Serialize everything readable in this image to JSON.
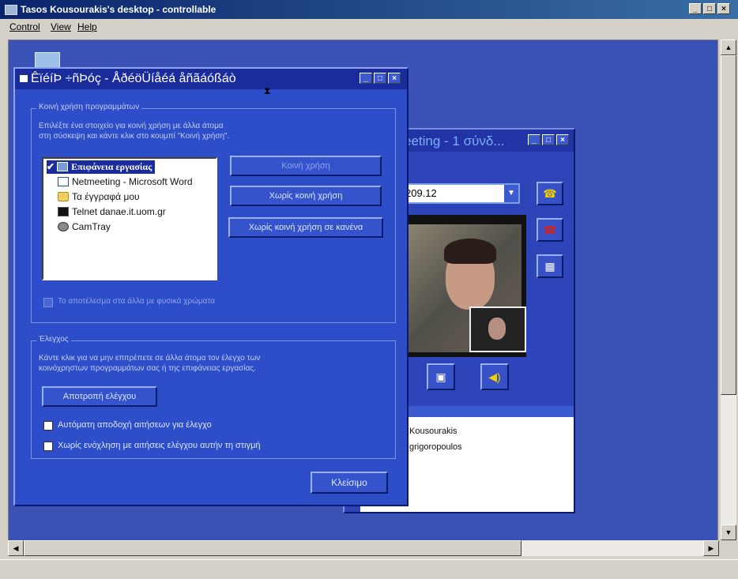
{
  "outer_window": {
    "title": "Tasos Kousourakis's desktop - controllable",
    "buttons": [
      "_",
      "□",
      "×"
    ]
  },
  "menu": [
    "Control",
    "View",
    "Help"
  ],
  "netmeeting": {
    "title": "eeting - 1 σύνδ...",
    "address": "209.12",
    "participants": [
      "Kousourakis",
      "grigoropoulos"
    ]
  },
  "dialog": {
    "title": "ÊïéíÞ ÷ñÞóç - ÅðéöÜíåéá åñãáóßáò",
    "group_sharing": {
      "label": "Κοινή χρήση προγραμμάτων",
      "description_line1": "Επιλέξτε ένα στοιχείο για κοινή χρήση με άλλα άτομα",
      "description_line2": "στη σύσκεψη και κάντε κλικ στο κουμπί \"Κοινή χρήση\"."
    },
    "programs": [
      {
        "label": "Επιφάνεια εργασίας",
        "icon": "desktop-icon",
        "selected": true,
        "checked": "✔"
      },
      {
        "label": "Netmeeting - Microsoft Word",
        "icon": "word-document-icon"
      },
      {
        "label": "Τα έγγραφά μου",
        "icon": "folder-icon"
      },
      {
        "label": "Telnet danae.it.uom.gr",
        "icon": "telnet-icon"
      },
      {
        "label": "CamTray",
        "icon": "camera-icon"
      }
    ],
    "buttons": {
      "share": "Κοινή χρήση",
      "unshare": "Χωρίς κοινή χρήση",
      "unshare_all": "Χωρίς κοινή χρήση σε κανένα"
    },
    "true_color": "Το αποτέλεσμα στα άλλα με φυσικά χρώματα",
    "group_control": {
      "label": "Έλεγχος",
      "description_line1": "Κάντε κλικ για να μην επιτρέπετε σε άλλα άτομα τον έλεγχο των",
      "description_line2": "κοινόχρηστων προγραμμάτων σας ή της επιφάνειας εργασίας."
    },
    "prevent_control": "Αποτροπή ελέγχου",
    "auto_accept": "Αυτόματη αποδοχή αιτήσεων για έλεγχο",
    "do_not_disturb": "Χωρίς ενόχληση με αιτήσεις ελέγχου αυτήν τη στιγμή",
    "close": "Κλείσιμο"
  }
}
